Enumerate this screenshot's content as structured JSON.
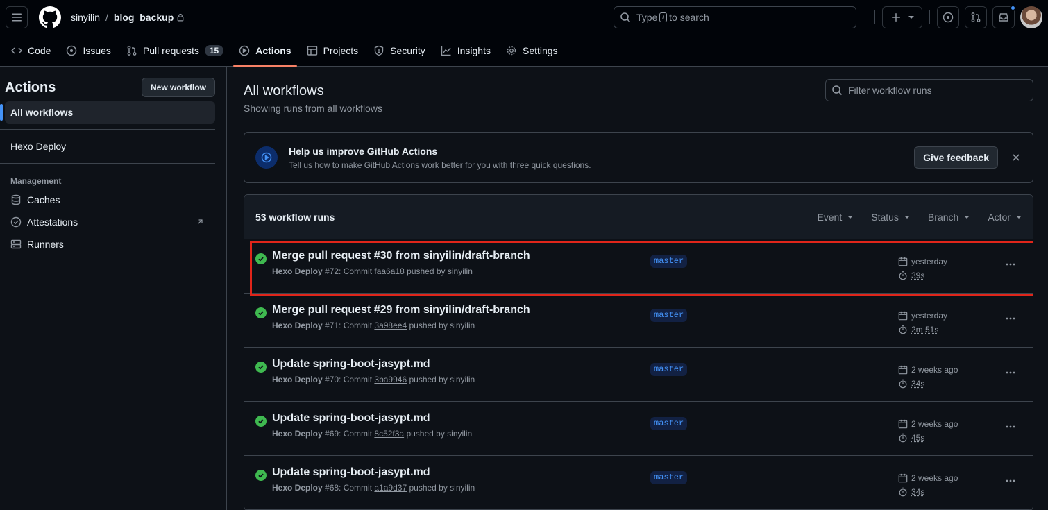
{
  "header": {
    "owner": "sinyilin",
    "separator": "/",
    "repo": "blog_backup",
    "search_prefix": "Type",
    "search_key": "/",
    "search_suffix": "to search"
  },
  "nav": {
    "items": [
      {
        "label": "Code",
        "icon": "code-icon"
      },
      {
        "label": "Issues",
        "icon": "issue-icon"
      },
      {
        "label": "Pull requests",
        "icon": "pull-request-icon",
        "count": "15"
      },
      {
        "label": "Actions",
        "icon": "play-icon",
        "active": true
      },
      {
        "label": "Projects",
        "icon": "table-icon"
      },
      {
        "label": "Security",
        "icon": "shield-icon"
      },
      {
        "label": "Insights",
        "icon": "graph-icon"
      },
      {
        "label": "Settings",
        "icon": "gear-icon"
      }
    ]
  },
  "sidebar": {
    "title": "Actions",
    "new_workflow": "New workflow",
    "all_workflows": "All workflows",
    "workflow": "Hexo Deploy",
    "group": "Management",
    "manage_items": [
      {
        "label": "Caches",
        "icon": "database-icon"
      },
      {
        "label": "Attestations",
        "icon": "verified-icon"
      },
      {
        "label": "Runners",
        "icon": "server-icon"
      }
    ]
  },
  "main": {
    "title": "All workflows",
    "subtitle": "Showing runs from all workflows",
    "filter_placeholder": "Filter workflow runs"
  },
  "banner": {
    "title": "Help us improve GitHub Actions",
    "text": "Tell us how to make GitHub Actions work better for you with three quick questions.",
    "button": "Give feedback"
  },
  "runs": {
    "count_label": "53 workflow runs",
    "filters": [
      "Event",
      "Status",
      "Branch",
      "Actor"
    ],
    "items": [
      {
        "title": "Merge pull request #30 from sinyilin/draft-branch",
        "workflow": "Hexo Deploy",
        "run": "#72: Commit",
        "sha": "faa6a18",
        "pushed": "pushed by sinyilin",
        "branch": "master",
        "when": "yesterday",
        "duration": "39s"
      },
      {
        "title": "Merge pull request #29 from sinyilin/draft-branch",
        "workflow": "Hexo Deploy",
        "run": "#71: Commit",
        "sha": "3a98ee4",
        "pushed": "pushed by sinyilin",
        "branch": "master",
        "when": "yesterday",
        "duration": "2m 51s"
      },
      {
        "title": "Update spring-boot-jasypt.md",
        "workflow": "Hexo Deploy",
        "run": "#70: Commit",
        "sha": "3ba9946",
        "pushed": "pushed by sinyilin",
        "branch": "master",
        "when": "2 weeks ago",
        "duration": "34s"
      },
      {
        "title": "Update spring-boot-jasypt.md",
        "workflow": "Hexo Deploy",
        "run": "#69: Commit",
        "sha": "8c52f3a",
        "pushed": "pushed by sinyilin",
        "branch": "master",
        "when": "2 weeks ago",
        "duration": "45s"
      },
      {
        "title": "Update spring-boot-jasypt.md",
        "workflow": "Hexo Deploy",
        "run": "#68: Commit",
        "sha": "a1a9d37",
        "pushed": "pushed by sinyilin",
        "branch": "master",
        "when": "2 weeks ago",
        "duration": "34s"
      }
    ]
  },
  "colors": {
    "accent": "#4493f8",
    "success": "#3fb950",
    "highlight": "#e0251a",
    "underline": "#f78166"
  }
}
